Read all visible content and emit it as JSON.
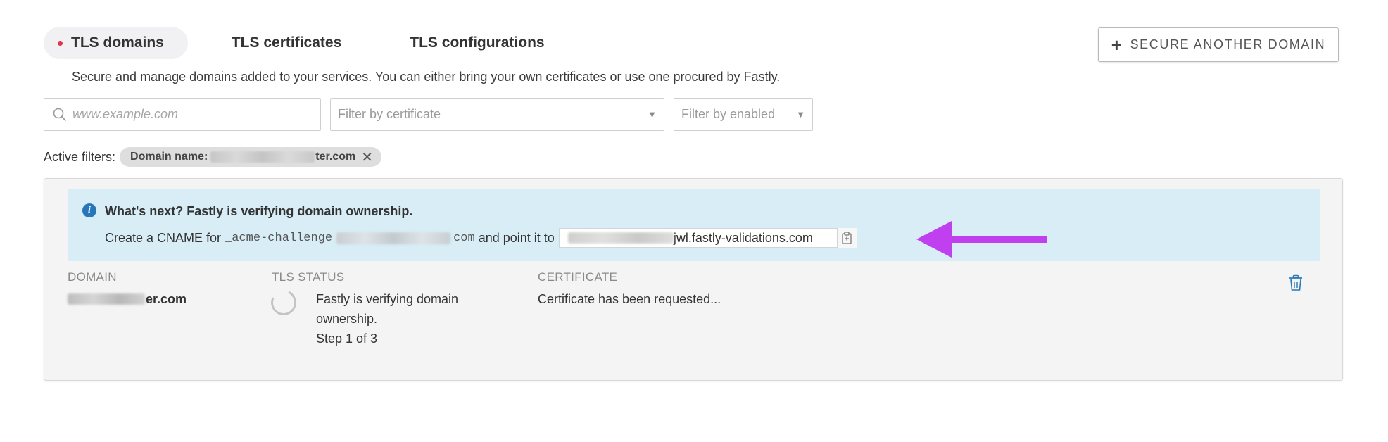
{
  "tabs": [
    {
      "label": "TLS domains",
      "active": true
    },
    {
      "label": "TLS certificates",
      "active": false
    },
    {
      "label": "TLS configurations",
      "active": false
    }
  ],
  "secure_button": {
    "icon": "plus-icon",
    "label": "SECURE ANOTHER DOMAIN"
  },
  "description": "Secure and manage domains added to your services. You can either bring your own certificates or use one procured by Fastly.",
  "filters": {
    "search_placeholder": "www.example.com",
    "certificate_placeholder": "Filter by certificate",
    "enabled_placeholder": "Filter by enabled"
  },
  "active_filters": {
    "label": "Active filters:",
    "chip_prefix": "Domain name:",
    "chip_suffix": "ter.com"
  },
  "notice": {
    "title": "What's next? Fastly is verifying domain ownership.",
    "line_prefix": "Create a CNAME for",
    "record_prefix": "_acme-challenge",
    "record_suffix": "com",
    "line_middle": "and point it to",
    "target_suffix": "jwl.fastly-validations.com"
  },
  "table": {
    "headers": {
      "domain": "DOMAIN",
      "tls_status": "TLS STATUS",
      "certificate": "CERTIFICATE"
    },
    "row": {
      "domain_suffix": "er.com",
      "status_line1": "Fastly is verifying domain",
      "status_line2": "ownership.",
      "status_step": "Step 1 of 3",
      "certificate": "Certificate has been requested..."
    }
  },
  "colors": {
    "accent_dot": "#e0334c",
    "info_blue": "#2676b9",
    "notice_bg": "#d8edf5",
    "arrow": "#c040f0",
    "trash": "#2a7ab8"
  }
}
